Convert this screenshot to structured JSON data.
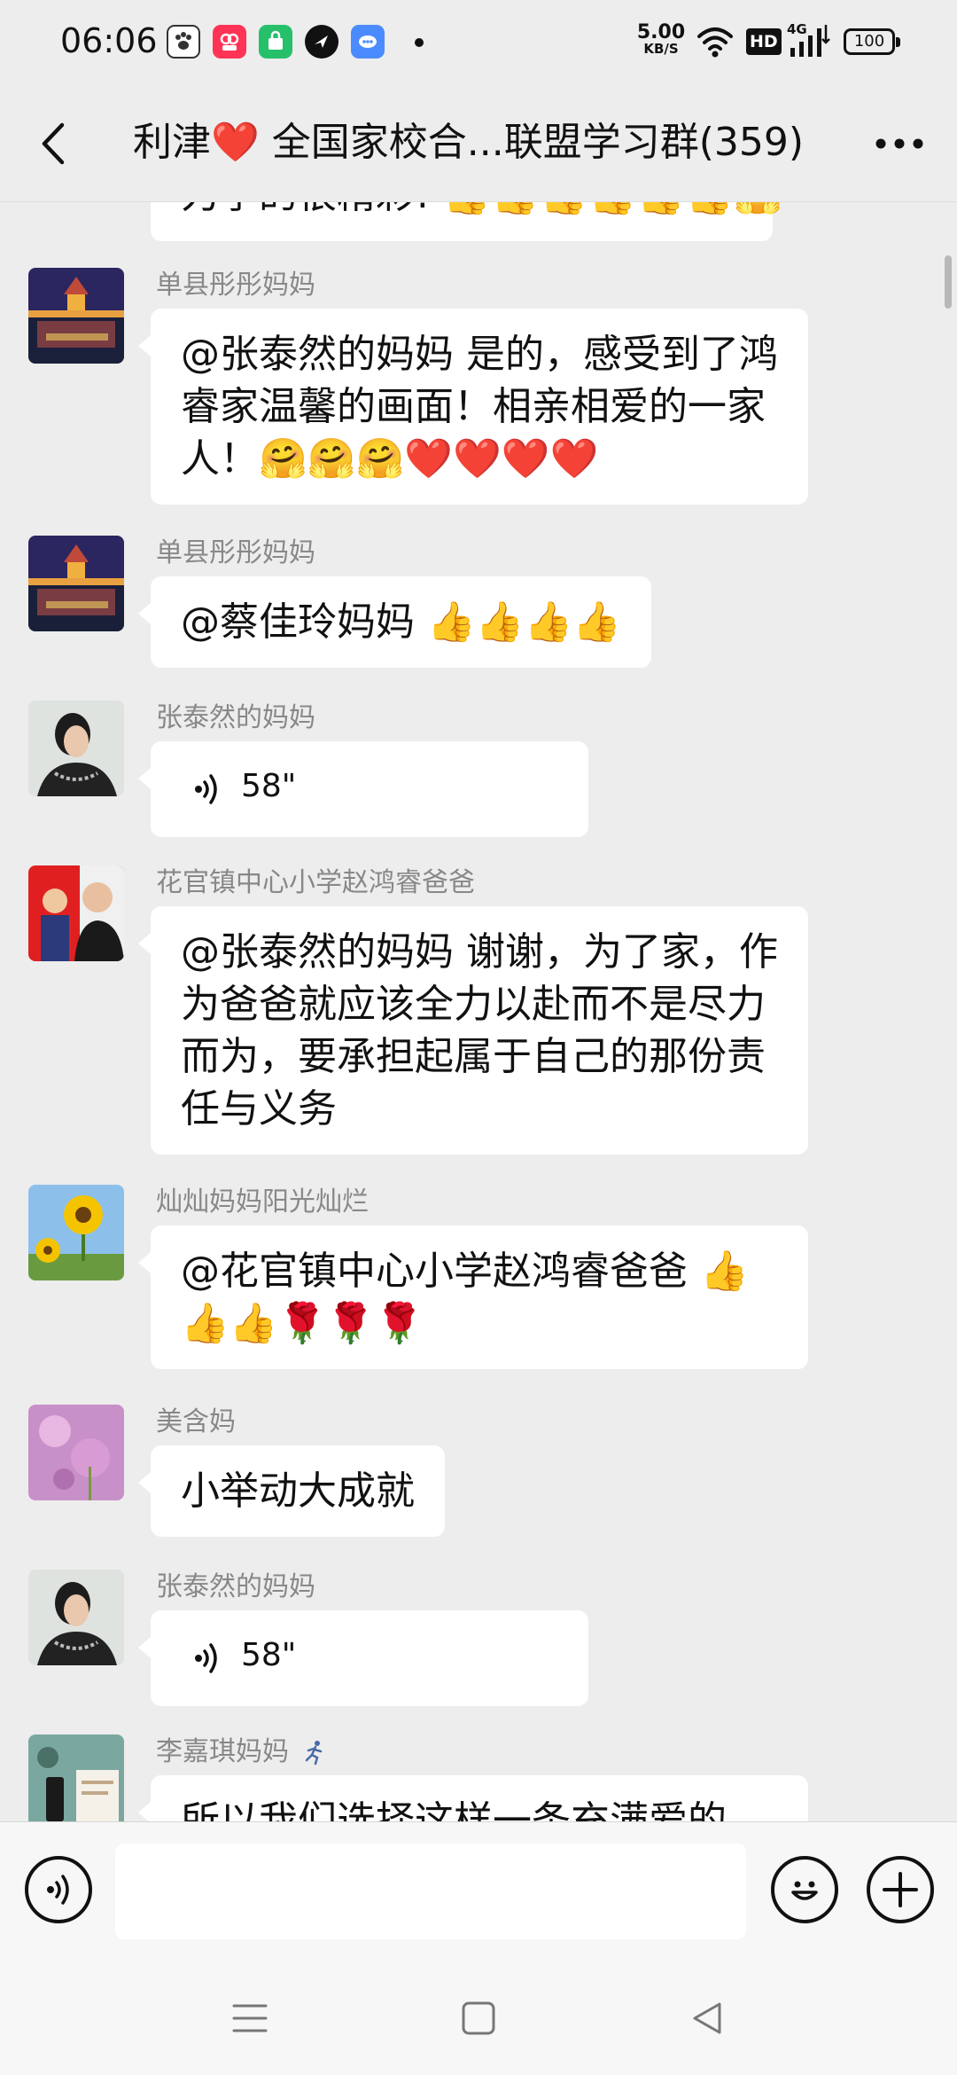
{
  "status_bar": {
    "time": "06:06",
    "net_speed_value": "5.00",
    "net_speed_unit": "KB/S",
    "hd": "HD",
    "network": "4G",
    "battery": "100",
    "notification_icons": [
      "paw-app-icon",
      "video-app-icon",
      "green-bag-app-icon",
      "black-bird-app-icon",
      "blue-chat-app-icon"
    ]
  },
  "header": {
    "title": "利津❤️ 全国家校合...联盟学习群(359)"
  },
  "messages": [
    {
      "type": "text",
      "text": "力学的很精彩! 👍👍👍👍👍👍🤗"
    },
    {
      "type": "text",
      "sender": "单县彤彤妈妈",
      "text": "@张泰然的妈妈  是的，感受到了鸿睿家温馨的画面！相亲相爱的一家人！🤗🤗🤗❤️❤️❤️❤️"
    },
    {
      "type": "text",
      "sender": "单县彤彤妈妈",
      "text": "@蔡佳玲妈妈 👍👍👍👍"
    },
    {
      "type": "voice",
      "sender": "张泰然的妈妈",
      "duration": "58\""
    },
    {
      "type": "text",
      "sender": "花官镇中心小学赵鸿睿爸爸",
      "text": "@张泰然的妈妈  谢谢，为了家，作为爸爸就应该全力以赴而不是尽力而为，要承担起属于自己的那份责任与义务"
    },
    {
      "type": "text",
      "sender": "灿灿妈妈阳光灿烂",
      "text_line1": "@花官镇中心小学赵鸿睿爸爸 👍",
      "text_line2": "👍👍🌹🌹🌹"
    },
    {
      "type": "text",
      "sender": "美含妈",
      "text": "小举动大成就"
    },
    {
      "type": "voice",
      "sender": "张泰然的妈妈",
      "duration": "58\""
    },
    {
      "type": "text",
      "sender": "李嘉琪妈妈",
      "text": "所以我们选择这样一条充满爱的"
    }
  ],
  "input": {
    "placeholder": ""
  },
  "colors": {
    "background": "#ededed",
    "bubble": "#ffffff",
    "sender_name": "#888888"
  }
}
